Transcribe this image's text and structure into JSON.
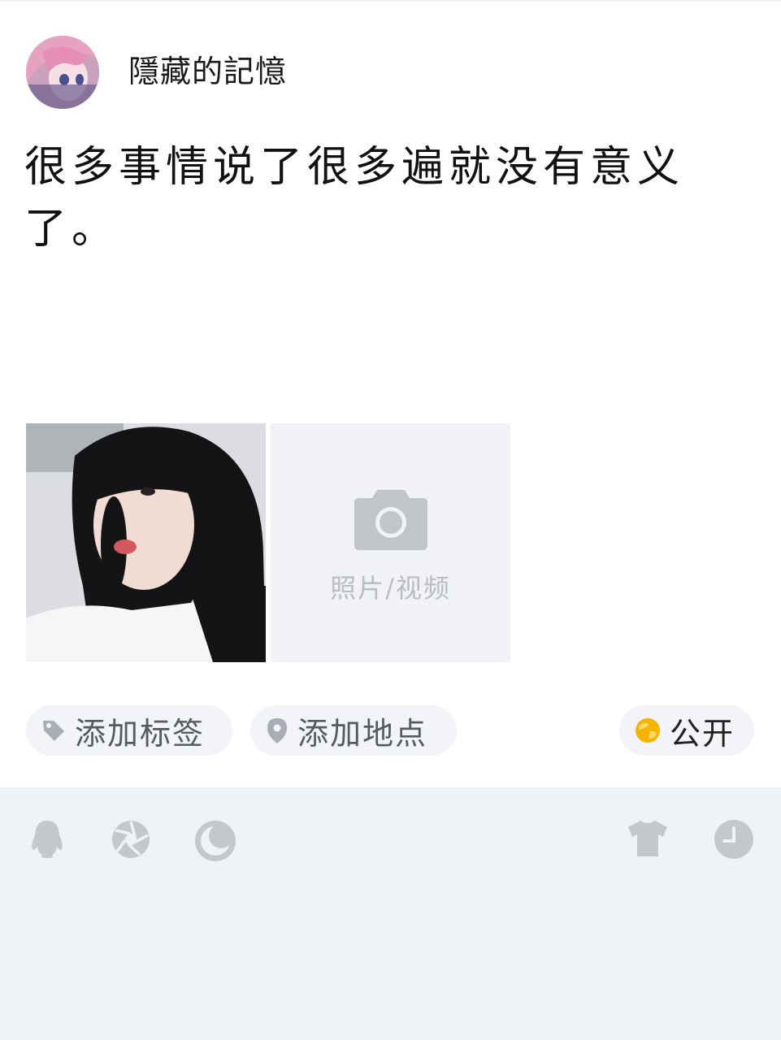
{
  "user": {
    "name": "隱藏的記憶"
  },
  "post": {
    "text": "很多事情说了很多遍就没有意义了。"
  },
  "media": {
    "add_label": "照片/视频"
  },
  "chips": {
    "tag": "添加标签",
    "location": "添加地点",
    "visibility": "公开"
  },
  "toolbar": [
    "qq-icon",
    "camera-shutter-icon",
    "moon-icon",
    "shirt-icon",
    "clock-icon"
  ],
  "colors": {
    "panel_bg": "#eff2f6",
    "chip_bg": "#f2f4f7",
    "icon_gray": "#c4c7cc",
    "accent": "#f5b400"
  }
}
